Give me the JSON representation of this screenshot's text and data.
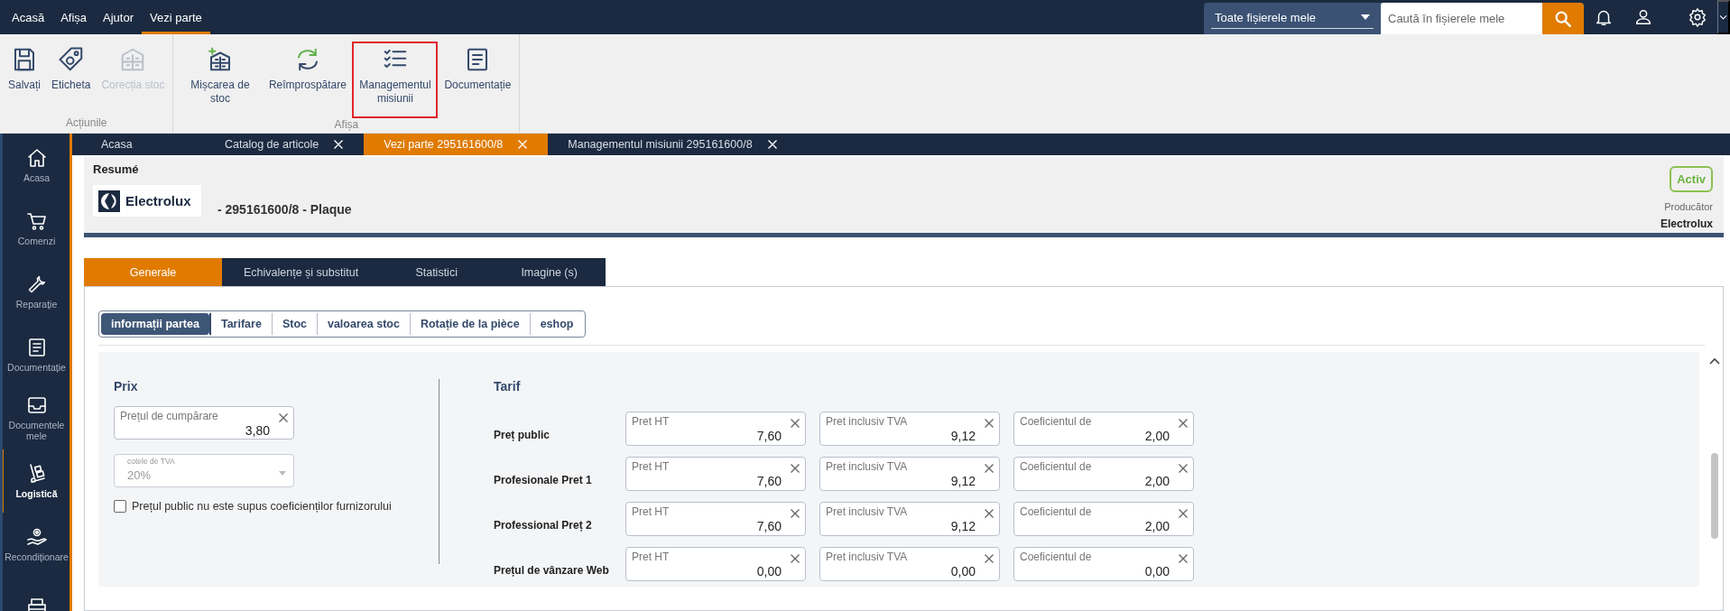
{
  "menu": [
    {
      "label": "Acasă",
      "selected": false
    },
    {
      "label": "Afișa",
      "selected": false
    },
    {
      "label": "Ajutor",
      "selected": false
    },
    {
      "label": "Vezi parte",
      "selected": true
    }
  ],
  "search": {
    "scope": "Toate fișierele mele",
    "placeholder": "Caută în fișierele mele"
  },
  "ribbon": {
    "groups": [
      {
        "label": "Acțiunile",
        "buttons": [
          {
            "label": "Salvați",
            "disabled": false,
            "highlighted": false
          },
          {
            "label": "Eticheta",
            "disabled": false,
            "highlighted": false
          },
          {
            "label": "Corecția stoc",
            "disabled": true,
            "highlighted": false
          }
        ]
      },
      {
        "label": "Afișa",
        "buttons": [
          {
            "label": "Mișcarea de stoc",
            "disabled": false,
            "highlighted": false
          },
          {
            "label": "Reîmprospătare",
            "disabled": false,
            "highlighted": false
          },
          {
            "label": "Managementul misiunii",
            "disabled": false,
            "highlighted": true
          },
          {
            "label": "Documentație",
            "disabled": false,
            "highlighted": false
          }
        ]
      }
    ]
  },
  "sidebar": {
    "items": [
      {
        "label": "Acasa",
        "selected": false
      },
      {
        "label": "Comenzi",
        "selected": false
      },
      {
        "label": "Reparație",
        "selected": false
      },
      {
        "label": "Documentație",
        "selected": false
      },
      {
        "label": "Documentele mele",
        "selected": false
      },
      {
        "label": "Logistică",
        "selected": true
      },
      {
        "label": "Recondiționare",
        "selected": false
      },
      {
        "selected": false
      }
    ]
  },
  "doc_tabs": [
    {
      "label": "Acasa",
      "closable": false,
      "selected": false
    },
    {
      "label": "Catalog de articole",
      "closable": true,
      "selected": false
    },
    {
      "label": "Vezi parte 295161600/8",
      "closable": true,
      "selected": true
    },
    {
      "label": "Managementul misiunii 295161600/8",
      "closable": true,
      "selected": false
    }
  ],
  "header": {
    "title": "Resumé",
    "logo_text": "Electrolux",
    "part": "- 295161600/8 - Plaque",
    "status": "Activ",
    "manufacturer_label": "Producător",
    "manufacturer": "Electrolux"
  },
  "section_tabs": [
    {
      "label": "Generale",
      "selected": true
    },
    {
      "label": "Echivalențe și substitut",
      "selected": false
    },
    {
      "label": "Statistici",
      "selected": false
    },
    {
      "label": "Imagine (s)",
      "selected": false
    }
  ],
  "sub_tabs": [
    {
      "label": "informații partea",
      "selected": true
    },
    {
      "label": "Tarifare",
      "selected": false
    },
    {
      "label": "Stoc",
      "selected": false
    },
    {
      "label": "valoarea stoc",
      "selected": false
    },
    {
      "label": "Rotație de la pièce",
      "selected": false
    },
    {
      "label": "eshop",
      "selected": false
    }
  ],
  "prix": {
    "title": "Prix",
    "purchase": {
      "label": "Prețul de cumpărare",
      "value": "3,80"
    },
    "vat": {
      "label": "cotele de TVA",
      "value": "20%",
      "disabled": true
    },
    "checkbox": {
      "label": "Prețul public nu este supus coeficienților furnizorului",
      "checked": false
    }
  },
  "tarif": {
    "title": "Tarif",
    "rows": [
      {
        "label": "Preț public",
        "fields": [
          {
            "label": "Pret HT",
            "value": "7,60"
          },
          {
            "label": "Pret inclusiv TVA",
            "value": "9,12"
          },
          {
            "label": "Coeficientul de",
            "value": "2,00"
          }
        ]
      },
      {
        "label": "Profesionale Pret 1",
        "fields": [
          {
            "label": "Pret HT",
            "value": "7,60"
          },
          {
            "label": "Pret inclusiv TVA",
            "value": "9,12"
          },
          {
            "label": "Coeficientul de",
            "value": "2,00"
          }
        ]
      },
      {
        "label": "Professional Preț 2",
        "fields": [
          {
            "label": "Pret HT",
            "value": "7,60"
          },
          {
            "label": "Pret inclusiv TVA",
            "value": "9,12"
          },
          {
            "label": "Coeficientul de",
            "value": "2,00"
          }
        ]
      },
      {
        "label": "Prețul de vânzare Web",
        "fields": [
          {
            "label": "Pret HT",
            "value": "0,00"
          },
          {
            "label": "Pret inclusiv TVA",
            "value": "0,00"
          },
          {
            "label": "Coeficientul de",
            "value": "0,00"
          }
        ]
      }
    ]
  }
}
